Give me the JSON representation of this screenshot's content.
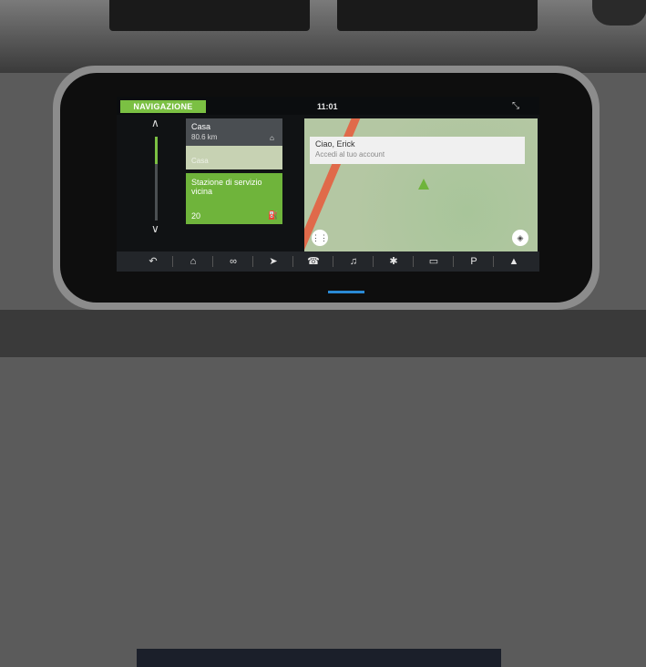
{
  "header": {
    "active_tab": "NAVIGAZIONE",
    "time": "11:01",
    "collapse_icon": "collapse-arrows-icon"
  },
  "favorites": {
    "up_icon": "chevron-up-icon",
    "down_icon": "chevron-down-icon",
    "cards": [
      {
        "title": "Casa",
        "distance": "80.6 km",
        "icon": "home-icon",
        "subtitle": "Casa"
      },
      {
        "title": "Stazione di servizio vicina",
        "count": "20",
        "icon": "fuel-icon"
      }
    ]
  },
  "map": {
    "greeting": "Ciao, Erick",
    "sign_in": "Accedi al tuo account",
    "menu_icon": "grid-icon",
    "layers_icon": "layers-icon"
  },
  "bottom_bar": {
    "items": [
      {
        "icon": "back-icon",
        "glyph": "↶"
      },
      {
        "icon": "home-icon",
        "glyph": "⌂"
      },
      {
        "icon": "connected-apps-icon",
        "glyph": "∞"
      },
      {
        "icon": "navigation-arrow-icon",
        "glyph": "➤"
      },
      {
        "icon": "phone-icon",
        "glyph": "☎"
      },
      {
        "icon": "media-icon",
        "glyph": "♫"
      },
      {
        "icon": "bluetooth-icon",
        "glyph": "✱"
      },
      {
        "icon": "camera-icon",
        "glyph": "▭"
      },
      {
        "icon": "parking-icon",
        "glyph": "P"
      },
      {
        "icon": "terrain-icon",
        "glyph": "▲"
      }
    ]
  },
  "colors": {
    "accent": "#7bc043",
    "card_green": "#6fb43b"
  }
}
